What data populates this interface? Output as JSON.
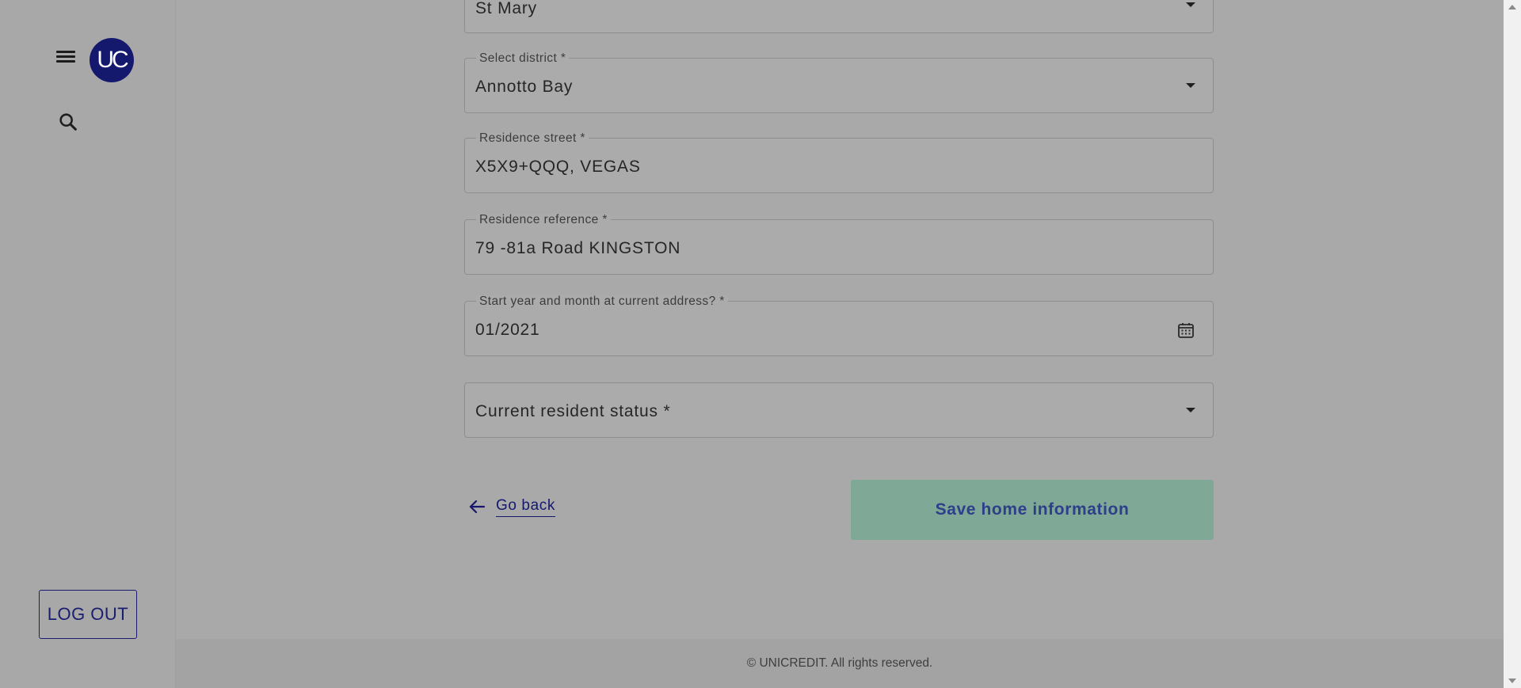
{
  "sidebar": {
    "logo_text": "UC",
    "logout_label": "LOG OUT"
  },
  "form": {
    "parish": {
      "value": "St Mary"
    },
    "district": {
      "label": "Select district *",
      "value": "Annotto Bay"
    },
    "street": {
      "label": "Residence street *",
      "value": "X5X9+QQQ, VEGAS"
    },
    "reference": {
      "label": "Residence reference *",
      "value": "79 -81a Road KINGSTON"
    },
    "start_date": {
      "label": "Start year and month at current address? *",
      "value": "01/2021"
    },
    "resident_status": {
      "placeholder": "Current resident status *"
    }
  },
  "actions": {
    "back_label": "Go back",
    "save_label": "Save home information"
  },
  "footer": {
    "copyright": "© UNICREDIT. All rights reserved."
  },
  "colors": {
    "brand": "#14196e",
    "save_button_bg": "#80a896",
    "overlay_bg": "#a9a9a9"
  },
  "icons": [
    "menu-icon",
    "search-icon",
    "chevron-down-icon",
    "calendar-icon",
    "arrow-left-icon"
  ]
}
